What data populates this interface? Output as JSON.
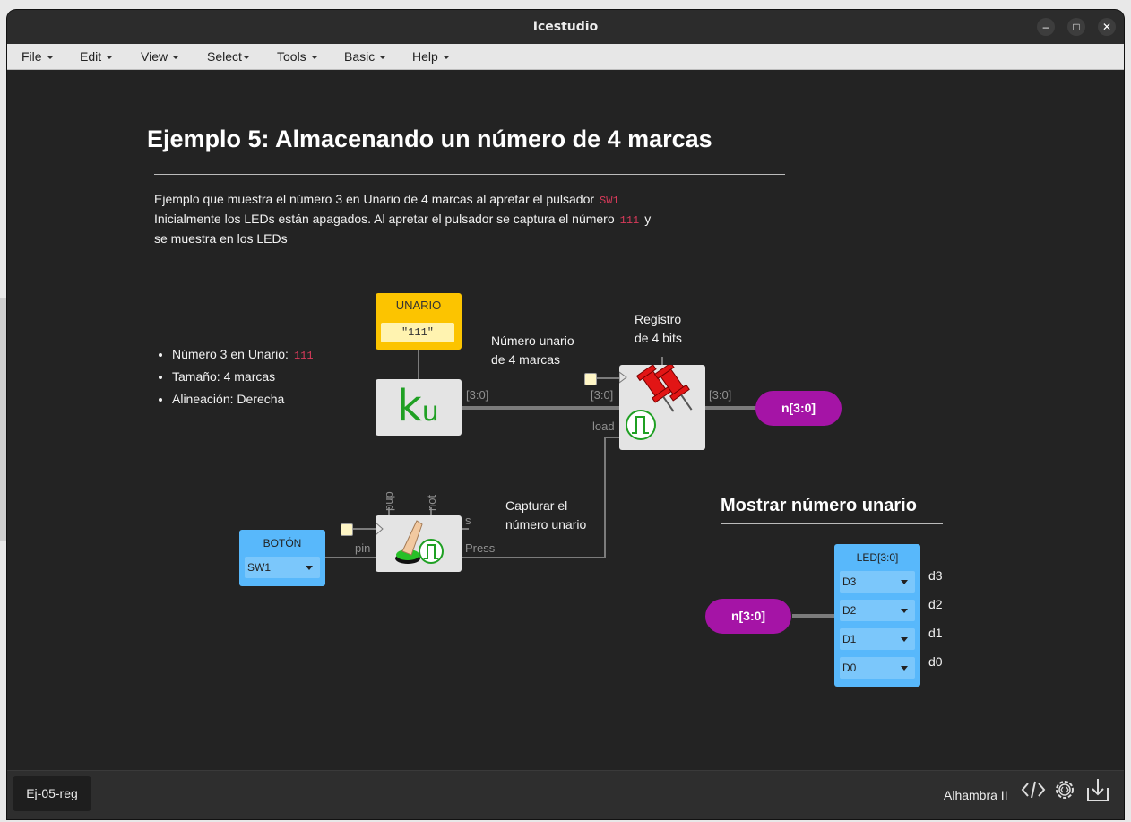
{
  "window": {
    "title": "Icestudio",
    "controls": {
      "minimize": "–",
      "maximize": "□",
      "close": "✕"
    }
  },
  "menu": [
    "File",
    "Edit",
    "View",
    "Select",
    "Tools",
    "Basic",
    "Help"
  ],
  "doc": {
    "title": "Ejemplo 5: Almacenando un número de 4 marcas",
    "line1": "Ejemplo que muestra el número 3 en Unario de 4 marcas al apretar el pulsador",
    "line1_code": "SW1",
    "line2": "Inicialmente los LEDs están apagados. Al apretar el pulsador se captura el número",
    "line2_code": "111",
    "line2_tail": "y",
    "line3": "se muestra en los LEDs"
  },
  "bullets": [
    {
      "text": "Número 3 en Unario:",
      "code": "111"
    },
    {
      "text": "Tamaño: 4 marcas",
      "code": ""
    },
    {
      "text": "Alineación: Derecha",
      "code": ""
    }
  ],
  "unario": {
    "title": "UNARIO",
    "value": "\"111\"",
    "symbol": "k",
    "sub": "u"
  },
  "notes": {
    "numero": [
      "Número unario",
      "de 4 marcas"
    ],
    "registro": [
      "Registro",
      "de 4 bits"
    ],
    "capturar": [
      "Capturar el",
      "número unario"
    ]
  },
  "labels": {
    "ku_out": "[3:0]",
    "reg_in": "[3:0]",
    "reg_out": "[3:0]",
    "load": "load",
    "pin": "pin",
    "press": "Press",
    "s": "s",
    "pup": "pup",
    "not": "not"
  },
  "boton": {
    "title": "BOTÓN",
    "value": "SW1"
  },
  "out_label": "n[3:0]",
  "in_label": "n[3:0]",
  "mostrar": {
    "title": "Mostrar número unario"
  },
  "led": {
    "title": "LED[3:0]",
    "pins": [
      "D3",
      "D2",
      "D1",
      "D0"
    ],
    "labels": [
      "d3",
      "d2",
      "d1",
      "d0"
    ]
  },
  "footer": {
    "tab": "Ej-05-reg",
    "board": "Alhambra II"
  },
  "colors": {
    "unario": "#fcc400",
    "boton": "#58b8fb",
    "pill": "#a514a6",
    "code": "#d73a5a"
  }
}
